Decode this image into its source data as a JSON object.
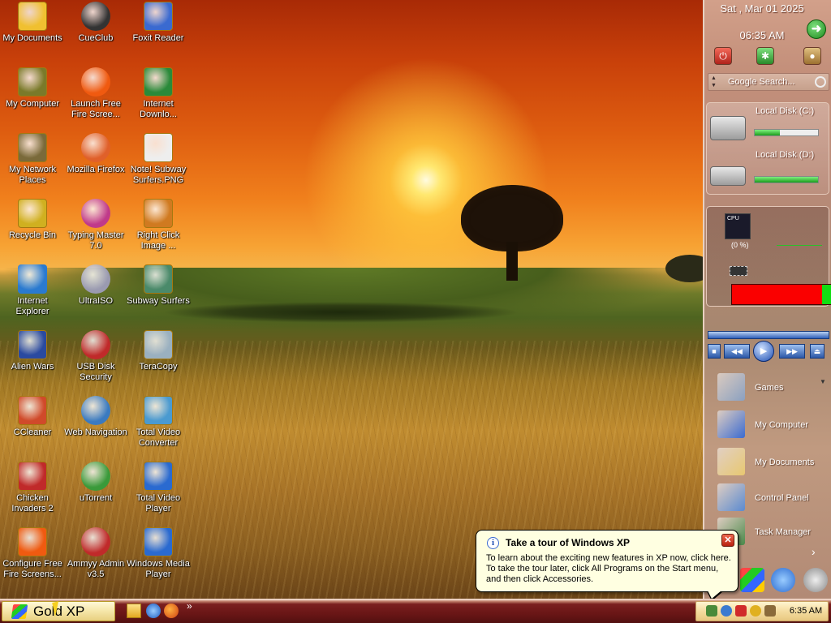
{
  "desktop_icons": [
    {
      "label": "My Documents",
      "icon": "folder-documents-icon",
      "col": 0,
      "row": 0
    },
    {
      "label": "CueClub",
      "icon": "cueclub-icon",
      "col": 1,
      "row": 0
    },
    {
      "label": "Foxit Reader",
      "icon": "foxit-reader-icon",
      "col": 2,
      "row": 0
    },
    {
      "label": "My Computer",
      "icon": "computer-icon",
      "col": 0,
      "row": 1
    },
    {
      "label": "Launch Free Fire Scree...",
      "icon": "fire-icon",
      "col": 1,
      "row": 1
    },
    {
      "label": "Internet Downlo...",
      "icon": "internet-download-icon",
      "col": 2,
      "row": 1
    },
    {
      "label": "My Network Places",
      "icon": "network-places-icon",
      "col": 0,
      "row": 2
    },
    {
      "label": "Mozilla Firefox",
      "icon": "firefox-icon",
      "col": 1,
      "row": 2
    },
    {
      "label": "Note! Subway Surfers.PNG",
      "icon": "png-file-icon",
      "col": 2,
      "row": 2
    },
    {
      "label": "Recycle Bin",
      "icon": "recycle-bin-icon",
      "col": 0,
      "row": 3
    },
    {
      "label": "Typing Master 7.0",
      "icon": "typing-master-icon",
      "col": 1,
      "row": 3
    },
    {
      "label": "Right Click Image ...",
      "icon": "right-click-image-icon",
      "col": 2,
      "row": 3
    },
    {
      "label": "Internet Explorer",
      "icon": "internet-explorer-icon",
      "col": 0,
      "row": 4
    },
    {
      "label": "UltraISO",
      "icon": "ultraiso-icon",
      "col": 1,
      "row": 4
    },
    {
      "label": "Subway Surfers",
      "icon": "subway-surfers-icon",
      "col": 2,
      "row": 4
    },
    {
      "label": "Alien Wars",
      "icon": "alien-wars-icon",
      "col": 0,
      "row": 5
    },
    {
      "label": "USB Disk Security",
      "icon": "usb-disk-security-icon",
      "col": 1,
      "row": 5
    },
    {
      "label": "TeraCopy",
      "icon": "teracopy-icon",
      "col": 2,
      "row": 5
    },
    {
      "label": "CCleaner",
      "icon": "ccleaner-icon",
      "col": 0,
      "row": 6
    },
    {
      "label": "Web Navigation",
      "icon": "web-navigation-icon",
      "col": 1,
      "row": 6
    },
    {
      "label": "Total Video Converter",
      "icon": "video-converter-icon",
      "col": 2,
      "row": 6
    },
    {
      "label": "Chicken Invaders 2",
      "icon": "chicken-invaders-icon",
      "col": 0,
      "row": 7
    },
    {
      "label": "uTorrent",
      "icon": "utorrent-icon",
      "col": 1,
      "row": 7
    },
    {
      "label": "Total Video Player",
      "icon": "video-player-icon",
      "col": 2,
      "row": 7
    },
    {
      "label": "Configure Free Fire Screens...",
      "icon": "fire-config-icon",
      "col": 0,
      "row": 8
    },
    {
      "label": "Ammyy Admin v3.5",
      "icon": "ammyy-admin-icon",
      "col": 1,
      "row": 8
    },
    {
      "label": "Windows Media Player",
      "icon": "windows-media-player-icon",
      "col": 2,
      "row": 8
    }
  ],
  "sidebar": {
    "date": "Sat , Mar 01 2025",
    "time": "06:35 AM",
    "search_placeholder": "Google Search...",
    "disks": [
      {
        "label": "Local Disk (C:)",
        "used_fraction": 0.4
      },
      {
        "label": "Local Disk (D:)",
        "used_fraction": 1.0
      }
    ],
    "cpu_label": "CPU",
    "cpu_percent": "(0 %)",
    "memory_free_fraction": 0.09,
    "menu": [
      {
        "label": "Games",
        "icon": "games-folder-icon"
      },
      {
        "label": "My Computer",
        "icon": "computer-icon"
      },
      {
        "label": "My Documents",
        "icon": "folder-documents-icon"
      },
      {
        "label": "Control Panel",
        "icon": "control-panel-icon"
      },
      {
        "label": "Task Manager",
        "icon": "task-manager-icon"
      }
    ]
  },
  "balloon": {
    "title": "Take a tour of Windows XP",
    "body": "To learn about the exciting new features in XP now, click here. To take the tour later, click All Programs on the Start menu, and then click Accessories."
  },
  "taskbar": {
    "start_label": "Gold XP",
    "overflow": "»",
    "clock": "6:35 AM"
  },
  "colors": {
    "accent": "#7a1f1f",
    "start_bg": "#f5e6a8",
    "balloon_bg": "#ffffe1",
    "memory_used": "#fa0000",
    "memory_free": "#12dd12"
  }
}
